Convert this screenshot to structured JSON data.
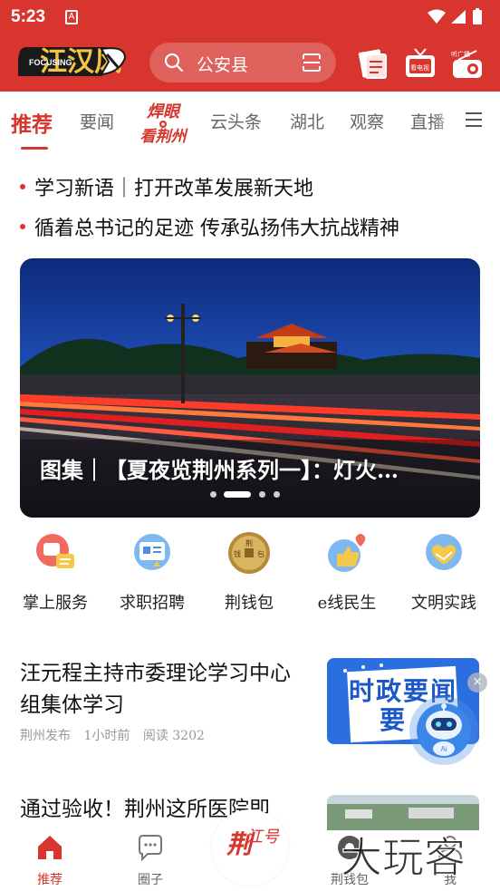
{
  "status_bar": {
    "time": "5:23",
    "notification_icon": "A"
  },
  "header": {
    "logo_text": "江汉风",
    "logo_sub": "FOCUSING",
    "search_placeholder": "公安县",
    "icons": [
      {
        "name": "read-paper-icon",
        "label": "读报"
      },
      {
        "name": "watch-tv-icon",
        "label": "看电视"
      },
      {
        "name": "listen-radio-icon",
        "label": "听广播"
      }
    ]
  },
  "tabs": {
    "items": [
      "推荐",
      "要闻",
      "云头条",
      "湖北",
      "观察",
      "直播"
    ],
    "special": {
      "line1": "焊眼",
      "line2": "看荆州"
    },
    "active_index": 0
  },
  "headlines": [
    "学习新语｜打开改革发展新天地",
    "循着总书记的足迹 传承弘扬伟大抗战精神"
  ],
  "banner": {
    "caption": "图集｜【夏夜览荆州系列一】：灯火…",
    "slide_count": 4,
    "active_slide": 1
  },
  "services": [
    {
      "label": "掌上服务",
      "icon": "palm-service-icon"
    },
    {
      "label": "求职招聘",
      "icon": "job-recruit-icon"
    },
    {
      "label": "荆钱包",
      "icon": "coin-wallet-icon",
      "icon_text": [
        "荆",
        "钱",
        "包"
      ]
    },
    {
      "label": "e线民生",
      "icon": "heart-thumb-icon"
    },
    {
      "label": "文明实践",
      "icon": "handshake-heart-icon"
    }
  ],
  "articles": [
    {
      "title": "汪元程主持市委理论学习中心组集体学习",
      "source": "荆州发布",
      "time": "1小时前",
      "reads": "阅读 3202",
      "thumb_text": "时政要闻"
    },
    {
      "title": "通过验收！荆州这所医院即"
    }
  ],
  "ai_assistant": {
    "label": "Ai",
    "close": "×"
  },
  "bottom_nav": {
    "items": [
      {
        "label": "推荐",
        "icon": "home-icon"
      },
      {
        "label": "圈子",
        "icon": "chat-bubble-icon"
      },
      {
        "label": "荆钱包",
        "icon": "wallet-icon"
      },
      {
        "label": "我",
        "icon": "user-icon"
      }
    ],
    "center_text": {
      "line1": "荆",
      "line2": "江号"
    },
    "active_index": 0
  },
  "watermark": "大玩客",
  "colors": {
    "brand_red": "#d7352d",
    "text_dark": "#111111",
    "text_muted": "#999999"
  }
}
